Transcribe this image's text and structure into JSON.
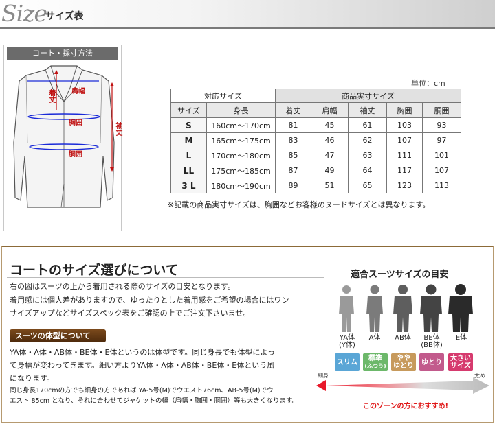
{
  "header": {
    "logo": "Size",
    "subtitle": "サイズ表"
  },
  "diagram": {
    "title": "コート・採寸方法",
    "labels": {
      "length": "着丈",
      "shoulder": "肩幅",
      "chest": "胸囲",
      "waist": "胴囲",
      "sleeve": "袖丈"
    },
    "colors": {
      "measure": "#1a2ad8",
      "label": "#c01010"
    }
  },
  "size_table": {
    "unit": "単位：cm",
    "group_headers": {
      "left": "対応サイズ",
      "right": "商品実寸サイズ"
    },
    "columns": [
      "サイズ",
      "身長",
      "着丈",
      "肩幅",
      "袖丈",
      "胸囲",
      "胴囲"
    ],
    "rows": [
      [
        "S",
        "160cm〜170cm",
        "81",
        "45",
        "61",
        "103",
        "93"
      ],
      [
        "M",
        "165cm〜175cm",
        "83",
        "46",
        "62",
        "107",
        "97"
      ],
      [
        "L",
        "170cm〜180cm",
        "85",
        "47",
        "63",
        "111",
        "101"
      ],
      [
        "LL",
        "175cm〜185cm",
        "87",
        "49",
        "64",
        "117",
        "107"
      ],
      [
        "3 L",
        "180cm〜190cm",
        "89",
        "51",
        "65",
        "123",
        "113"
      ]
    ],
    "note": "※記載の商品実寸サイズは、胸囲などお客様のヌードサイズとは異なります。"
  },
  "guide": {
    "title": "コートのサイズ選びについて",
    "paragraph1": [
      "右の図はスーツの上から着用される際のサイズの目安となります。",
      "着用感には個人差がありますので、ゆったりとした着用感をご希望の場合にはワン",
      "サイズアップなどサイズスペック表をご確認の上でご注文下さいませ。"
    ],
    "sub_title": "スーツの体型について",
    "paragraph2": [
      "YA体・A体・AB体・BE体・E体というのは体型です。同じ身長でも体型によっ",
      "て身幅が変わってきます。細い方よりYA体・A体・AB体・BE体・E体という風",
      "になります。"
    ],
    "paragraph3": [
      "同じ身長170cmの方でも細身の方であれば YA-5号(M)でウエスト76cm、AB-5号(M)でウ",
      "エスト 85cm となり、それに合わせてジャケットの幅（肩幅・胸囲・胴囲）等も大きくなります。"
    ]
  },
  "figures": {
    "title": "適合スーツサイズの目安",
    "items": [
      {
        "label": "YA体",
        "sub": "(Y体)",
        "tag": "スリム",
        "tag2": "",
        "color": "#9a9a9a",
        "tag_color": "#5aa6d6"
      },
      {
        "label": "A体",
        "sub": "",
        "tag": "標準",
        "tag2": "(ふつう)",
        "color": "#7b7b7b",
        "tag_color": "#6cb86a"
      },
      {
        "label": "AB体",
        "sub": "",
        "tag": "やや",
        "tag2": "ゆとり",
        "color": "#5e5e5e",
        "tag_color": "#c79a5c"
      },
      {
        "label": "BE体",
        "sub": "(BB体)",
        "tag": "ゆとり",
        "tag2": "",
        "color": "#444444",
        "tag_color": "#c25a8c"
      },
      {
        "label": "E体",
        "sub": "",
        "tag": "大きい",
        "tag2": "サイズ",
        "color": "#2a2a2a",
        "tag_color": "#d63a6e"
      }
    ],
    "scale_left": "細身",
    "scale_right": "太め",
    "recommend": "このゾーンの方におすすめ!"
  }
}
